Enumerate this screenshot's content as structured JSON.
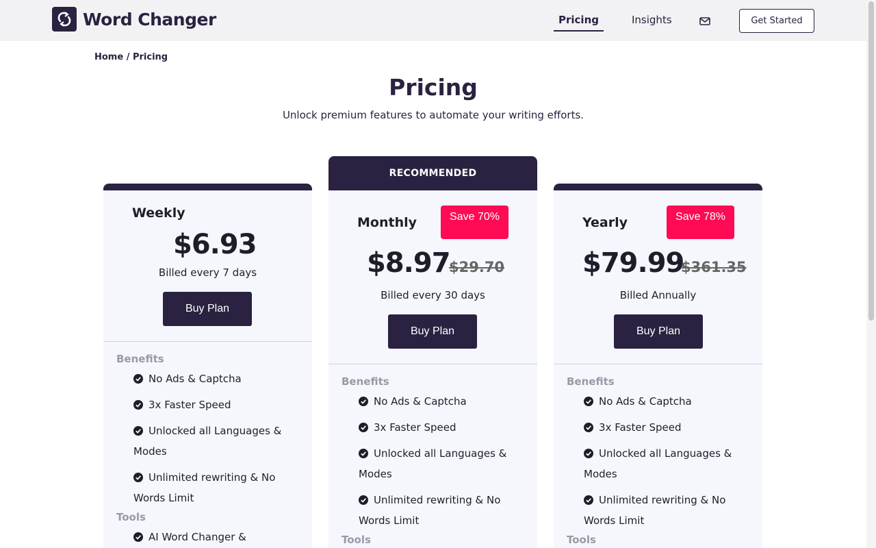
{
  "brand": {
    "name": "Word Changer"
  },
  "nav": {
    "pricing": "Pricing",
    "insights": "Insights",
    "get_started": "Get Started"
  },
  "breadcrumb": "Home / Pricing",
  "page": {
    "title": "Pricing",
    "subtitle": "Unlock premium features to automate your writing efforts."
  },
  "colors": {
    "primary": "#2b2140",
    "accent": "#ff0a54",
    "card_bg": "#f5f7fd"
  },
  "plans": [
    {
      "name": "Weekly",
      "price": "$6.93",
      "billed": "Billed every 7 days",
      "buy": "Buy Plan",
      "benefits_label": "Benefits",
      "benefits": [
        "No Ads & Captcha",
        "3x Faster Speed",
        "Unlocked all Languages & Modes",
        "Unlimited rewriting & No Words Limit"
      ],
      "tools_label": "Tools",
      "tools": [
        "AI Word Changer &"
      ]
    },
    {
      "recommended": "RECOMMENDED",
      "name": "Monthly",
      "save": "Save 70%",
      "price": "$8.97",
      "old_price": "$29.70",
      "billed": "Billed every 30 days",
      "buy": "Buy Plan",
      "benefits_label": "Benefits",
      "benefits": [
        "No Ads & Captcha",
        "3x Faster Speed",
        "Unlocked all Languages & Modes",
        "Unlimited rewriting & No Words Limit"
      ],
      "tools_label": "Tools"
    },
    {
      "name": "Yearly",
      "save": "Save 78%",
      "price": "$79.99",
      "old_price": "$361.35",
      "billed": "Billed Annually",
      "buy": "Buy Plan",
      "benefits_label": "Benefits",
      "benefits": [
        "No Ads & Captcha",
        "3x Faster Speed",
        "Unlocked all Languages & Modes",
        "Unlimited rewriting & No Words Limit"
      ],
      "tools_label": "Tools"
    }
  ],
  "icons": {
    "logo": "refresh-icon",
    "mail": "mail-icon",
    "check": "check-circle-icon"
  }
}
